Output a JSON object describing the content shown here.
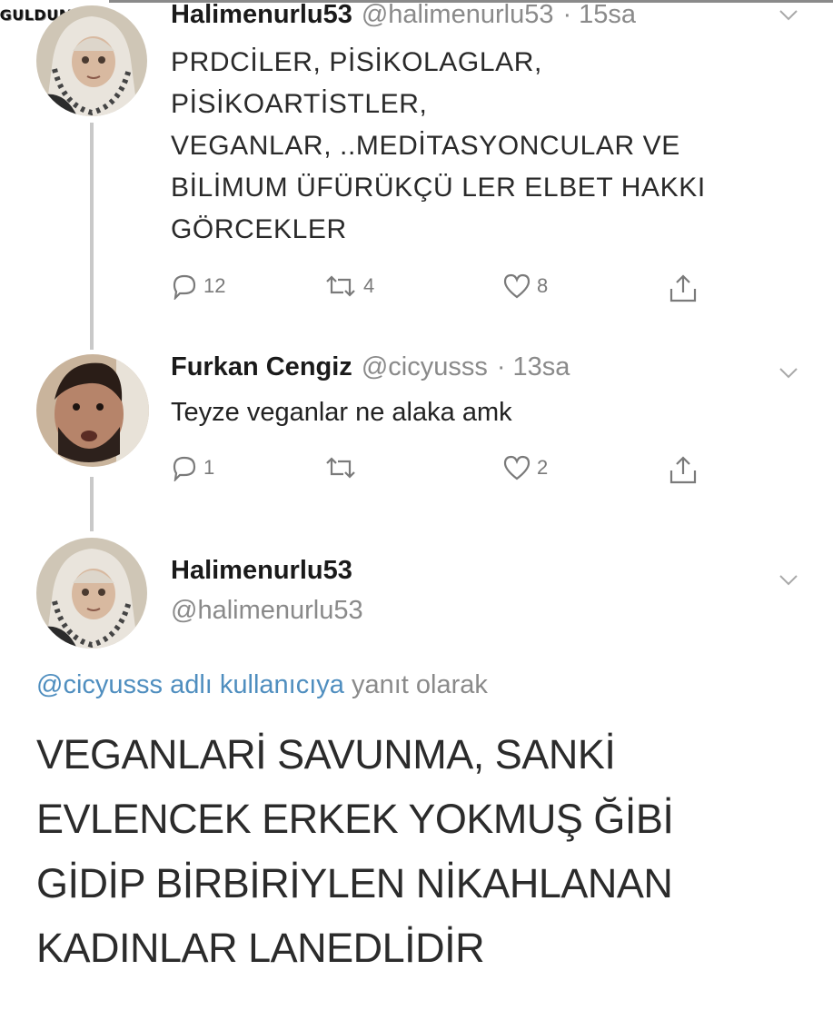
{
  "watermark": "GULDUM.NET",
  "tweets": [
    {
      "name": "Halimenurlu53",
      "handle": "@halimenurlu53",
      "time": "· 15sa",
      "text": "PRDCİLER, PİSİKOLAGLAR,\nPİSİKOARTİSTLER,\nVEGANLAR, ..MEDİTASYONCULAR VE\nBİLİMUM ÜFÜRÜKÇÜ LER ELBET HAKKI\nGÖRCEKLER",
      "replies": "12",
      "retweets": "4",
      "likes": "8"
    },
    {
      "name": "Furkan Cengiz",
      "handle": "@cicyusss",
      "time": "· 13sa",
      "text": "Teyze veganlar ne alaka amk",
      "replies": "1",
      "retweets": "",
      "likes": "2"
    }
  ],
  "focus_tweet": {
    "name": "Halimenurlu53",
    "handle": "@halimenurlu53",
    "replying_link": "@cicyusss adlı kullanıcıya",
    "replying_rest": "yanıt olarak",
    "text": "VEGANLARİ  SAVUNMA, SANKİ\nEVLENCEK ERKEK YOKMUŞ ĞİBİ\nGİDİP BİRBİRİYLEN NİKAHLANAN\nKADINLAR LANEDLİDİR"
  },
  "icons": {
    "chevron": "chevron-down-icon",
    "reply": "reply-icon",
    "retweet": "retweet-icon",
    "like": "heart-icon",
    "share": "share-icon"
  },
  "colors": {
    "link": "#4f8ebf",
    "muted": "#8a8a8a",
    "icon": "#7a7a7a"
  }
}
